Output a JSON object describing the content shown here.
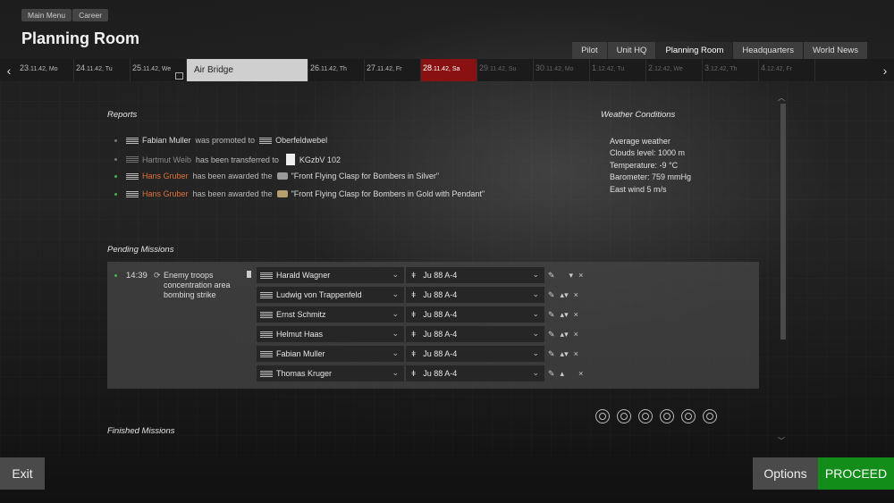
{
  "breadcrumb": [
    "Main Menu",
    "Career"
  ],
  "page_title": "Planning Room",
  "nav_tabs": [
    {
      "label": "Pilot",
      "active": false
    },
    {
      "label": "Unit HQ",
      "active": false
    },
    {
      "label": "Planning Room",
      "active": true
    },
    {
      "label": "Headquarters",
      "active": false
    },
    {
      "label": "World News",
      "active": false
    }
  ],
  "dates": [
    {
      "day": "23",
      "rest": ".11.42, Mo",
      "state": "past"
    },
    {
      "day": "24",
      "rest": ".11.42, Tu",
      "state": "past"
    },
    {
      "day": "25",
      "rest": ".11.42, We",
      "state": "past"
    },
    {
      "event": "Air Bridge",
      "state": "event"
    },
    {
      "day": "26",
      "rest": ".11.42, Th",
      "state": "past"
    },
    {
      "day": "27",
      "rest": ".11.42, Fr",
      "state": "past"
    },
    {
      "day": "28",
      "rest": ".11.42, Sa",
      "state": "current"
    },
    {
      "day": "29",
      "rest": ".11.42, Su",
      "state": "future"
    },
    {
      "day": "30",
      "rest": ".11.42, Mo",
      "state": "future"
    },
    {
      "day": "1",
      "rest": ".12.42, Tu",
      "state": "future"
    },
    {
      "day": "2",
      "rest": ".12.42, We",
      "state": "future"
    },
    {
      "day": "3",
      "rest": ".12.42, Th",
      "state": "future"
    },
    {
      "day": "4",
      "rest": ".12.42, Fr",
      "state": "future"
    }
  ],
  "reports_title": "Reports",
  "reports": [
    {
      "name": "Fabian Muller",
      "action": "was promoted to",
      "target": "Oberfeldwebel",
      "dot": "grey",
      "name_color": "normal"
    },
    {
      "name": "Hartmut Weib",
      "action": "has been transferred to",
      "target": "KGzbV 102",
      "dot": "grey",
      "name_color": "grey"
    },
    {
      "name": "Hans Gruber",
      "action": "has been awarded the",
      "target": "\"Front Flying Clasp for Bombers in Silver\"",
      "dot": "green",
      "name_color": "orange"
    },
    {
      "name": "Hans Gruber",
      "action": "has been awarded the",
      "target": "\"Front Flying Clasp for Bombers in Gold with Pendant\"",
      "dot": "green",
      "name_color": "orange"
    }
  ],
  "weather": {
    "title": "Weather Conditions",
    "lines": [
      "Average weather",
      "Clouds level: 1000 m",
      "Temperature: -9 °C",
      "Barometer: 759 mmHg",
      "East wind 5 m/s"
    ]
  },
  "pending_title": "Pending Missions",
  "mission": {
    "time": "14:39",
    "name": "Enemy troops concentration area bombing strike",
    "crew": [
      {
        "pilot": "Harald Wagner",
        "plane": "Ju 88 A-4"
      },
      {
        "pilot": "Ludwig von Trappenfeld",
        "plane": "Ju 88 A-4"
      },
      {
        "pilot": "Ernst Schmitz",
        "plane": "Ju 88 A-4"
      },
      {
        "pilot": "Helmut Haas",
        "plane": "Ju 88 A-4"
      },
      {
        "pilot": "Fabian Muller",
        "plane": "Ju 88 A-4"
      },
      {
        "pilot": "Thomas Kruger",
        "plane": "Ju 88 A-4"
      }
    ]
  },
  "finished_title": "Finished Missions",
  "buttons": {
    "exit": "Exit",
    "options": "Options",
    "proceed": "PROCEED"
  }
}
